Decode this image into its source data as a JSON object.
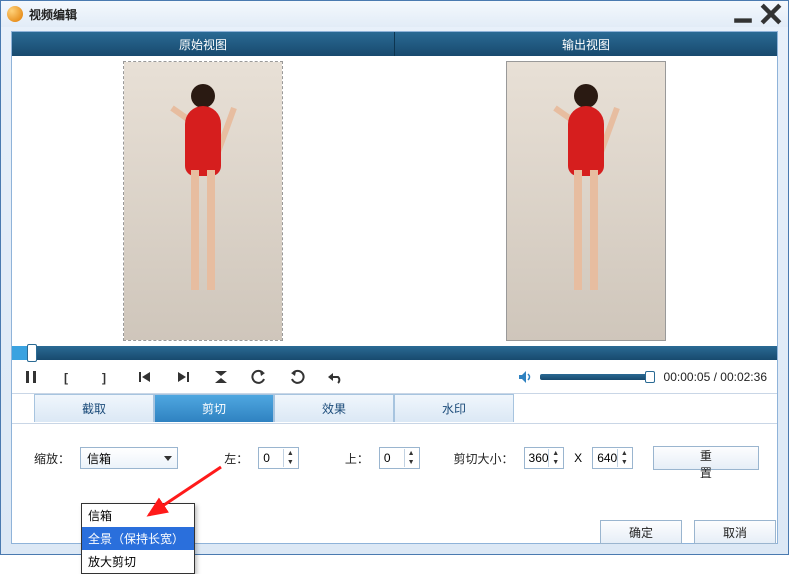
{
  "window": {
    "title": "视频编辑"
  },
  "header": {
    "original": "原始视图",
    "output": "输出视图"
  },
  "tabs": {
    "crop": "截取",
    "trim": "剪切",
    "effect": "效果",
    "watermark": "水印",
    "active": "trim"
  },
  "scale": {
    "label": "缩放：",
    "value": "信箱",
    "options": [
      "信箱",
      "全景（保持长宽）",
      "放大剪切"
    ],
    "selected_index": 1
  },
  "left": {
    "label": "左：",
    "value": "0"
  },
  "top": {
    "label": "上：",
    "value": "0"
  },
  "cropsize": {
    "label": "剪切大小：",
    "w": "360",
    "sep": "X",
    "h": "640"
  },
  "buttons": {
    "reset": "重置",
    "ok": "确定",
    "cancel": "取消"
  },
  "time": {
    "current": "00:00:05",
    "total": "00:02:36",
    "sep": " / "
  },
  "icons": {
    "play_pause": "pause",
    "bracket_l": "[",
    "bracket_r": "]",
    "prev": "prev",
    "next": "next",
    "contract": "contract",
    "rot_ccw": "ccw",
    "rot_cw": "cw",
    "undo": "undo",
    "vol": "vol"
  }
}
